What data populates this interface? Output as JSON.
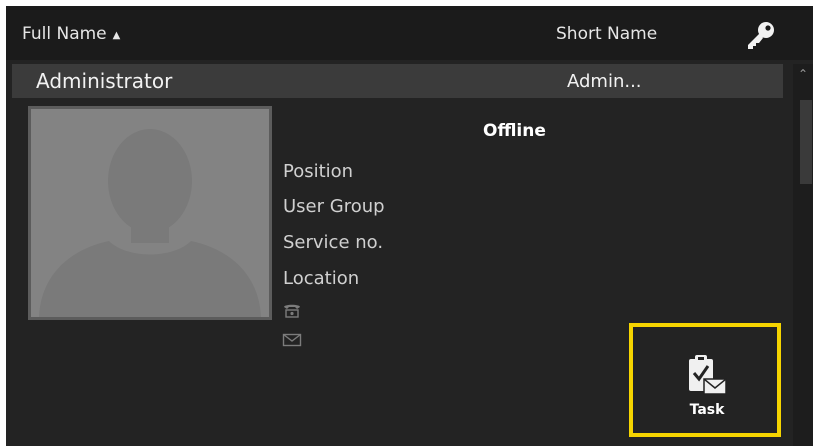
{
  "header": {
    "full_name_label": "Full Name",
    "sort_indicator": "▲",
    "short_name_label": "Short Name",
    "key_icon": "key-icon"
  },
  "user": {
    "full_name": "Administrator",
    "short_name": "Admin...",
    "status": "Offline",
    "fields": {
      "position": "Position",
      "user_group": "User Group",
      "service_no": "Service no.",
      "location": "Location"
    },
    "icons": [
      "person-silhouette-icon",
      "phone-icon",
      "mail-icon"
    ]
  },
  "actions": {
    "task_label": "Task",
    "task_icon": "clipboard-task-icon"
  },
  "colors": {
    "background": "#232323",
    "header_bg": "#1b1b1b",
    "selected_row": "#3b3b3b",
    "highlight": "#f5d400",
    "photo_bg": "#828282"
  }
}
